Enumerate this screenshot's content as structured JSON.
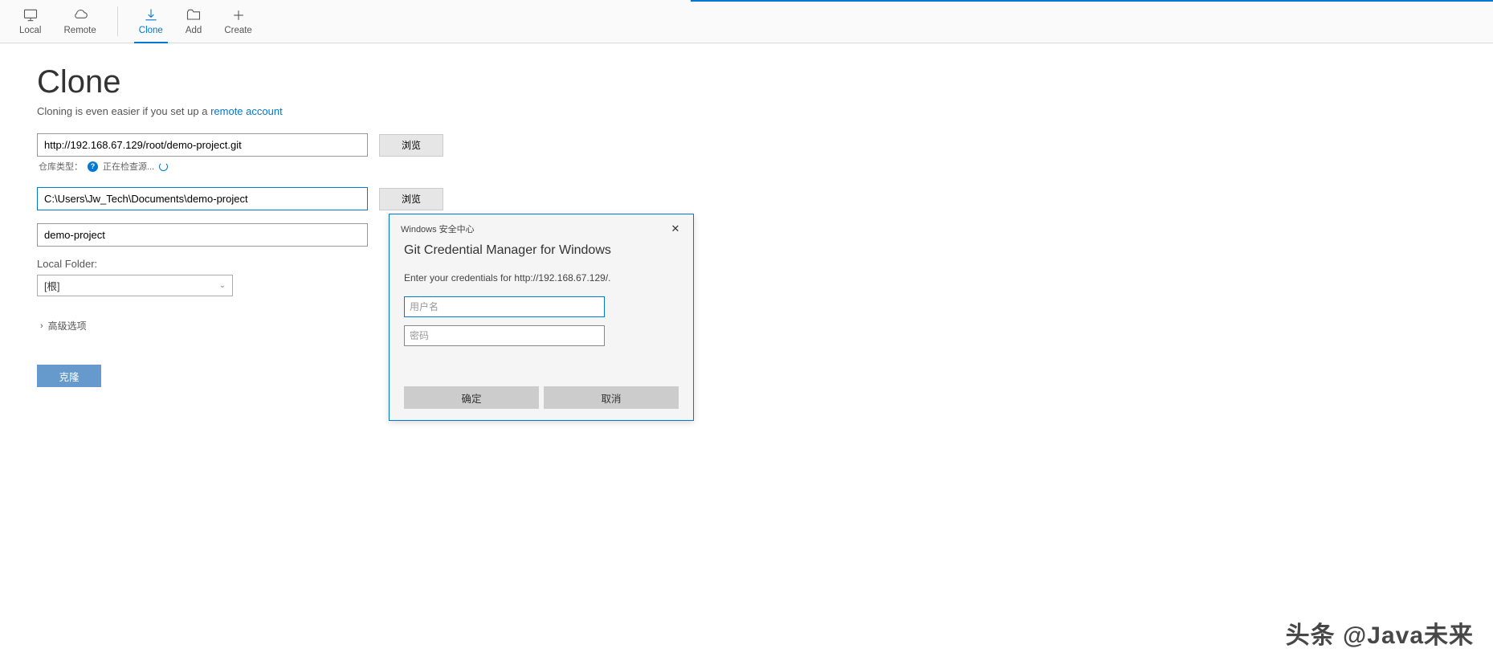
{
  "toolbar": {
    "items": [
      {
        "label": "Local"
      },
      {
        "label": "Remote"
      },
      {
        "label": "Clone"
      },
      {
        "label": "Add"
      },
      {
        "label": "Create"
      }
    ]
  },
  "page": {
    "title": "Clone",
    "subtitle_prefix": "Cloning is even easier if you set up a ",
    "subtitle_link": "remote account"
  },
  "form": {
    "source_url": "http://192.168.67.129/root/demo-project.git",
    "browse_label": "浏览",
    "repo_type_label": "仓库类型：",
    "checking_label": "正在检查源...",
    "dest_path": "C:\\Users\\Jw_Tech\\Documents\\demo-project",
    "name": "demo-project",
    "local_folder_label": "Local Folder:",
    "local_folder_value": "[根]",
    "advanced_label": "高级选项",
    "clone_button": "克隆"
  },
  "dialog": {
    "window_title": "Windows 安全中心",
    "title": "Git Credential Manager for Windows",
    "prompt": "Enter your credentials for http://192.168.67.129/.",
    "username_placeholder": "用户名",
    "password_placeholder": "密码",
    "ok_label": "确定",
    "cancel_label": "取消"
  },
  "watermark": "头条 @Java未来"
}
